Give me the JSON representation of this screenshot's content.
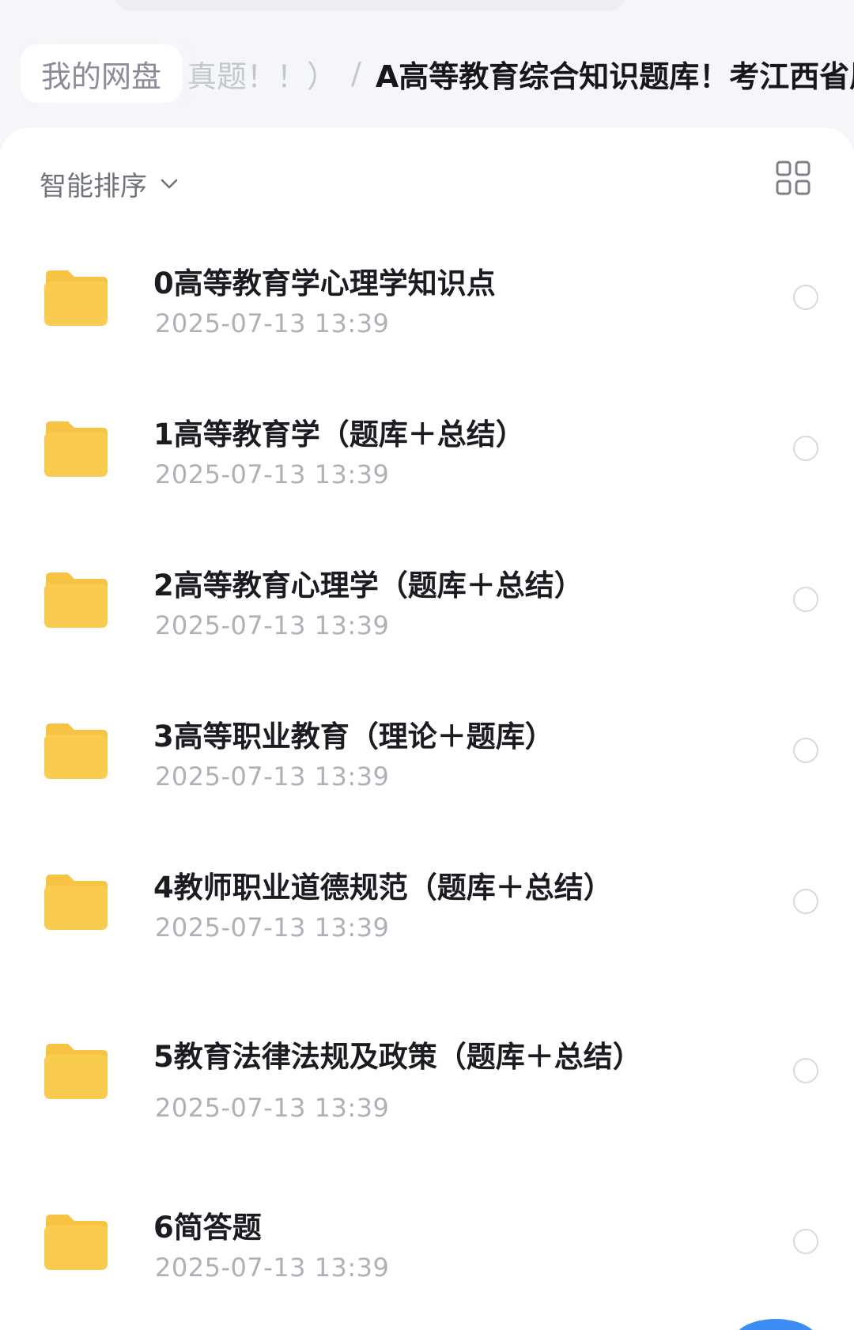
{
  "breadcrumb": {
    "home": "我的网盘",
    "previous": "真题！！）",
    "separator": "/",
    "current": "A高等教育综合知识题库！考江西省属"
  },
  "toolbar": {
    "sort_label": "智能排序",
    "sort_icon": "chevron-down-icon",
    "view_icon": "grid-view-icon"
  },
  "files": [
    {
      "name": "0高等教育学心理学知识点",
      "date": "2025-07-13 13:39",
      "icon": "folder-icon"
    },
    {
      "name": "1高等教育学（题库＋总结）",
      "date": "2025-07-13 13:39",
      "icon": "folder-icon"
    },
    {
      "name": "2高等教育心理学（题库＋总结）",
      "date": "2025-07-13 13:39",
      "icon": "folder-icon"
    },
    {
      "name": "3高等职业教育（理论＋题库）",
      "date": "2025-07-13 13:39",
      "icon": "folder-icon"
    },
    {
      "name": "4教师职业道德规范（题库＋总结）",
      "date": "2025-07-13 13:39",
      "icon": "folder-icon"
    },
    {
      "name": "5教育法律法规及政策（题库＋总结）",
      "date": "2025-07-13 13:39",
      "icon": "folder-icon"
    },
    {
      "name": "6简答题",
      "date": "2025-07-13 13:39",
      "icon": "folder-icon"
    }
  ],
  "colors": {
    "folder": "#f9cc4f",
    "folder_tab": "#f6c344",
    "accent": "#3d8bf5"
  }
}
